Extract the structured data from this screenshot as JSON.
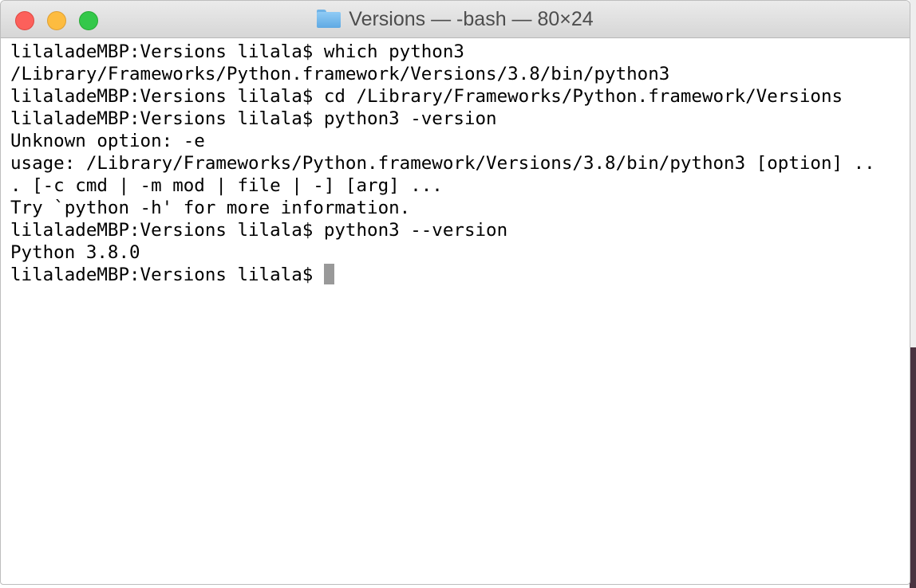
{
  "window": {
    "title": "Versions — -bash — 80×24",
    "folder_icon": "folder-icon",
    "traffic_lights": {
      "close_color": "#fc605b",
      "minimize_color": "#fdbc40",
      "zoom_color": "#34c84a"
    }
  },
  "terminal": {
    "lines": [
      "lilaladeMBP:Versions lilala$ which python3",
      "/Library/Frameworks/Python.framework/Versions/3.8/bin/python3",
      "lilaladeMBP:Versions lilala$ cd /Library/Frameworks/Python.framework/Versions",
      "lilaladeMBP:Versions lilala$ python3 -version",
      "Unknown option: -e",
      "usage: /Library/Frameworks/Python.framework/Versions/3.8/bin/python3 [option] ..",
      ". [-c cmd | -m mod | file | -] [arg] ...",
      "Try `python -h' for more information.",
      "lilaladeMBP:Versions lilala$ python3 --version",
      "Python 3.8.0"
    ],
    "prompt": "lilaladeMBP:Versions lilala$ "
  }
}
